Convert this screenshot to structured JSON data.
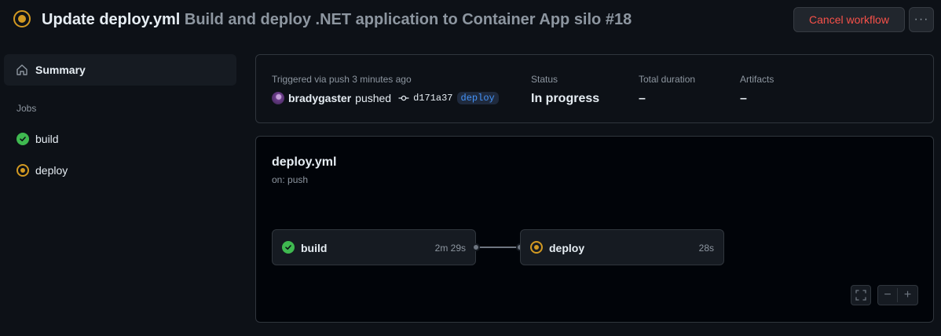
{
  "header": {
    "title_bold": "Update deploy.yml",
    "title_rest": " Build and deploy .NET application to Container App silo #18",
    "cancel_label": "Cancel workflow",
    "more_label": "···"
  },
  "sidebar": {
    "summary_label": "Summary",
    "jobs_heading": "Jobs",
    "jobs": [
      {
        "label": "build",
        "status": "success"
      },
      {
        "label": "deploy",
        "status": "in_progress"
      }
    ]
  },
  "summary": {
    "trigger": "Triggered via push 3 minutes ago",
    "actor": "bradygaster",
    "action": "pushed",
    "commit": "d171a37",
    "branch": "deploy",
    "status_label": "Status",
    "status_value": "In progress",
    "duration_label": "Total duration",
    "duration_value": "–",
    "artifacts_label": "Artifacts",
    "artifacts_value": "–"
  },
  "graph": {
    "workflow_name": "deploy.yml",
    "trigger": "on: push",
    "jobs": [
      {
        "name": "build",
        "duration": "2m 29s",
        "status": "success"
      },
      {
        "name": "deploy",
        "duration": "28s",
        "status": "in_progress"
      }
    ],
    "zoom_out": "−",
    "zoom_in": "+"
  },
  "colors": {
    "background": "#0d1117",
    "success": "#3fb950",
    "in_progress": "#d29922",
    "danger": "#f85149",
    "link": "#4493f8"
  }
}
